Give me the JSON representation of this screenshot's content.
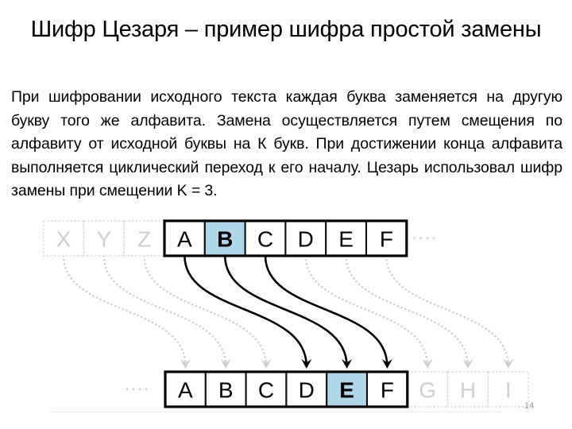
{
  "slide": {
    "title": "Шифр Цезаря – пример шифра простой замены",
    "body": "При шифровании исходного текста каждая буква заменяется на другую букву того же алфавита. Замена осуществляется путем смещения по алфавиту от исходной буквы на К букв. При достижении конца алфавита выполняется циклический переход к его началу. Цезарь использовал шифр замены при смещении K = 3.",
    "page_number": "14"
  },
  "diagram": {
    "shift": 3,
    "highlight_color": "#b0d7e8",
    "box_border_color": "#000000",
    "faded_color": "#d8d8d8",
    "ellipsis": "• • • •",
    "plain_row": {
      "label": "plaintext-alphabet-row",
      "leading_ellipsis": "",
      "trailing_ellipsis": "• • • •",
      "cells": [
        {
          "letter": "X",
          "state": "faded",
          "highlighted": false
        },
        {
          "letter": "Y",
          "state": "faded",
          "highlighted": false
        },
        {
          "letter": "Z",
          "state": "faded",
          "highlighted": false
        },
        {
          "letter": "A",
          "state": "solid",
          "highlighted": false
        },
        {
          "letter": "B",
          "state": "solid",
          "highlighted": true
        },
        {
          "letter": "C",
          "state": "solid",
          "highlighted": false
        },
        {
          "letter": "D",
          "state": "solid",
          "highlighted": false
        },
        {
          "letter": "E",
          "state": "solid",
          "highlighted": false
        },
        {
          "letter": "F",
          "state": "solid",
          "highlighted": false
        }
      ]
    },
    "cipher_row": {
      "label": "ciphertext-alphabet-row",
      "leading_ellipsis": "• • • •",
      "trailing_ellipsis": "",
      "cells": [
        {
          "letter": "A",
          "state": "solid",
          "highlighted": false
        },
        {
          "letter": "B",
          "state": "solid",
          "highlighted": false
        },
        {
          "letter": "C",
          "state": "solid",
          "highlighted": false
        },
        {
          "letter": "D",
          "state": "solid",
          "highlighted": false
        },
        {
          "letter": "E",
          "state": "solid",
          "highlighted": true
        },
        {
          "letter": "F",
          "state": "solid",
          "highlighted": false
        },
        {
          "letter": "G",
          "state": "faded",
          "highlighted": false
        },
        {
          "letter": "H",
          "state": "faded",
          "highlighted": false
        },
        {
          "letter": "I",
          "state": "faded",
          "highlighted": false
        }
      ]
    },
    "mappings": [
      {
        "from": "X",
        "to": "A",
        "state": "faded"
      },
      {
        "from": "Y",
        "to": "B",
        "state": "faded"
      },
      {
        "from": "Z",
        "to": "C",
        "state": "faded"
      },
      {
        "from": "A",
        "to": "D",
        "state": "solid"
      },
      {
        "from": "B",
        "to": "E",
        "state": "solid"
      },
      {
        "from": "C",
        "to": "F",
        "state": "solid"
      },
      {
        "from": "D",
        "to": "G",
        "state": "faded"
      },
      {
        "from": "E",
        "to": "H",
        "state": "faded"
      },
      {
        "from": "F",
        "to": "I",
        "state": "faded"
      }
    ]
  }
}
